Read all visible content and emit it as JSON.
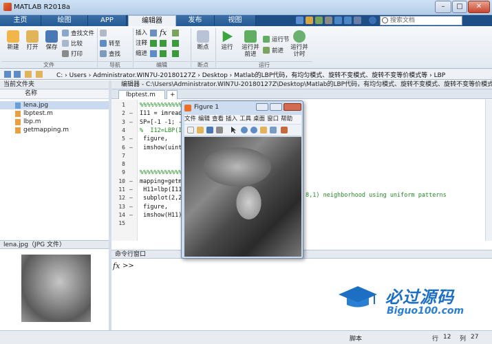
{
  "window": {
    "title": "MATLAB R2018a",
    "min": "–",
    "max": "□",
    "close": "✕"
  },
  "tabs": [
    {
      "label": "主页"
    },
    {
      "label": "绘图"
    },
    {
      "label": "APP"
    },
    {
      "label": "编辑器"
    },
    {
      "label": "发布"
    },
    {
      "label": "视图"
    }
  ],
  "search": {
    "placeholder": "搜索文档"
  },
  "ribbon": {
    "file": {
      "new": "新建",
      "open": "打开",
      "save": "保存",
      "find_files": "查找文件",
      "compare": "比较",
      "print": "打印",
      "section": "文件"
    },
    "nav": {
      "goto": "转至",
      "find": "查找",
      "section": "导航"
    },
    "edit": {
      "insert": "插入",
      "comment": "注释",
      "indent": "缩进",
      "section": "编辑"
    },
    "breakpoints": {
      "label": "断点",
      "section": "断点"
    },
    "run": {
      "run": "运行",
      "run_advance": "运行并\n前进",
      "run_section": "运行节",
      "advance": "前进",
      "run_time": "运行并\n计时",
      "section": "运行"
    }
  },
  "address": {
    "path": "C: › Users › Administrator.WIN7U-20180127Z › Desktop › Matlab的LBP代码，有均匀模式、旋转不变模式、旋转不变等价模式等 › LBP"
  },
  "current_folder": {
    "title": "当前文件夹",
    "column": "名称",
    "files": [
      "lena.jpg",
      "lbptest.m",
      "lbp.m",
      "getmapping.m"
    ]
  },
  "details": {
    "title": "lena.jpg（JPG 文件）"
  },
  "editor": {
    "title": "编辑器 - C:\\Users\\Administrator.WIN7U-20180127Z\\Desktop\\Matlab的LBP代码，有均匀模式、旋转不变模式、旋转不变等价模式等\\LBP\\l...",
    "tab": "lbptest.m",
    "add_tab": "+",
    "lines": [
      {
        "n": "1",
        "d": "",
        "t": "%%%%%%%%%%%%"
      },
      {
        "n": "2",
        "d": "–",
        "t": "I11 = imread("
      },
      {
        "n": "3",
        "d": "–",
        "t": "SP=[-1 -1; -1"
      },
      {
        "n": "4",
        "d": "",
        "t": "%  I12=LBP(I1"
      },
      {
        "n": "5",
        "d": "–",
        "t": " figure,"
      },
      {
        "n": "6",
        "d": "–",
        "t": " imshow(uint8"
      },
      {
        "n": "7",
        "d": "",
        "t": ""
      },
      {
        "n": "8",
        "d": "",
        "t": ""
      },
      {
        "n": "9",
        "d": "",
        "t": "%%%%%%%%%%%%"
      },
      {
        "n": "10",
        "d": "–",
        "t": "mapping=getma"
      },
      {
        "n": "11",
        "d": "–",
        "t": " H11=lbp(I11,"
      },
      {
        "n": "12",
        "d": "–",
        "t": " subplot(2,2,"
      },
      {
        "n": "13",
        "d": "–",
        "t": " figure,"
      },
      {
        "n": "14",
        "d": "–",
        "t": " imshow(H11);"
      },
      {
        "n": "15",
        "d": "",
        "t": ""
      }
    ],
    "overflow_comment": "8,1) neighborhood using uniform patterns"
  },
  "command": {
    "title": "命令行窗口",
    "fx": "fx",
    "prompt": ">>"
  },
  "status": {
    "mode": "脚本",
    "row_label": "行",
    "row": "12",
    "col_label": "列",
    "col": "27"
  },
  "figure": {
    "title": "Figure 1",
    "menu": [
      "文件",
      "编辑",
      "查看",
      "插入",
      "工具",
      "桌面",
      "窗口",
      "帮助"
    ]
  },
  "watermark": {
    "cn": "必过源码",
    "en": "Biguo100.com"
  },
  "colors": {
    "tabbar": "#1d4f86",
    "accent": "#1d6fc4",
    "comment": "#228b22"
  }
}
